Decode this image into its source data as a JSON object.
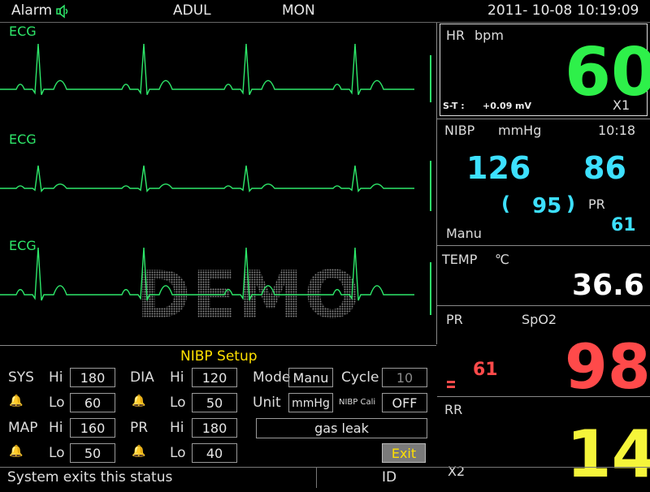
{
  "topbar": {
    "alarm": "Alarm",
    "patient_type": "ADUL",
    "mode": "MON",
    "date": "2011- 10-08",
    "time": "10:19:09"
  },
  "waves": {
    "labels": [
      "ECG",
      "ECG",
      "ECG"
    ],
    "watermark": "DEMO"
  },
  "hr": {
    "label": "HR",
    "unit": "bpm",
    "value": "60",
    "st_label": "S-T :",
    "st_value": "+0.09",
    "st_unit": "mV",
    "gain": "X1",
    "color": "#2ef04a"
  },
  "nibp": {
    "label": "NIBP",
    "unit": "mmHg",
    "time": "10:18",
    "sys": "126",
    "dia": "86",
    "open_paren": "(",
    "mean": "95",
    "close_paren": ")",
    "pr_label": "PR",
    "pr_value": "61",
    "mode": "Manu",
    "color": "#3de0ff"
  },
  "temp": {
    "label": "TEMP",
    "unit": "℃",
    "value": "36.6"
  },
  "spo2": {
    "pr_label": "PR",
    "label": "SpO2",
    "pr_value": "61",
    "value": "98",
    "color": "#ff4a4a"
  },
  "rr": {
    "label": "RR",
    "gain": "X2",
    "value": "14",
    "color": "#f5f53a"
  },
  "setup": {
    "title": "NIBP Setup",
    "sys": {
      "label": "SYS",
      "hi_label": "Hi",
      "hi": "180",
      "lo_label": "Lo",
      "lo": "60"
    },
    "dia": {
      "label": "DIA",
      "hi_label": "Hi",
      "hi": "120",
      "lo_label": "Lo",
      "lo": "50"
    },
    "map": {
      "label": "MAP",
      "hi_label": "Hi",
      "hi": "160",
      "lo_label": "Lo",
      "lo": "50"
    },
    "pr": {
      "label": "PR",
      "hi_label": "Hi",
      "hi": "180",
      "lo_label": "Lo",
      "lo": "40"
    },
    "mode_label": "Mode",
    "mode_value": "Manu",
    "cycle_label": "Cycle",
    "cycle_value": "10",
    "unit_label": "Unit",
    "unit_value": "mmHg",
    "cali_label": "NIBP Cali",
    "cali_value": "OFF",
    "gas_leak": "gas leak",
    "exit": "Exit"
  },
  "status": {
    "message": "System exits this status",
    "id": "ID"
  },
  "wave_color": "#2ee86a"
}
